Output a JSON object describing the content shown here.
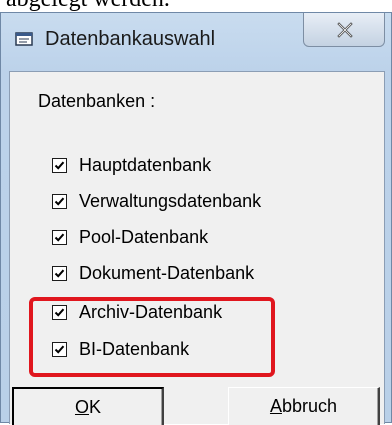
{
  "background_text": "abgelegt werden.",
  "dialog": {
    "title": "Datenbankauswahl",
    "group_label": "Datenbanken :",
    "checkboxes": [
      {
        "label": "Hauptdatenbank",
        "checked": true
      },
      {
        "label": "Verwaltungsdatenbank",
        "checked": true
      },
      {
        "label": "Pool-Datenbank",
        "checked": true
      },
      {
        "label": "Dokument-Datenbank",
        "checked": true
      },
      {
        "label": "Archiv-Datenbank",
        "checked": true
      },
      {
        "label": "BI-Datenbank",
        "checked": true
      }
    ],
    "ok_label": "OK",
    "ok_label_accel": "O",
    "ok_label_rest": "K",
    "cancel_label": "Abbruch",
    "cancel_label_accel": "A",
    "cancel_label_rest": "bbruch",
    "highlight_color": "#e0161e"
  },
  "icons": {
    "title": "database-window-icon",
    "close": "close-icon",
    "check": "checkmark-icon"
  }
}
